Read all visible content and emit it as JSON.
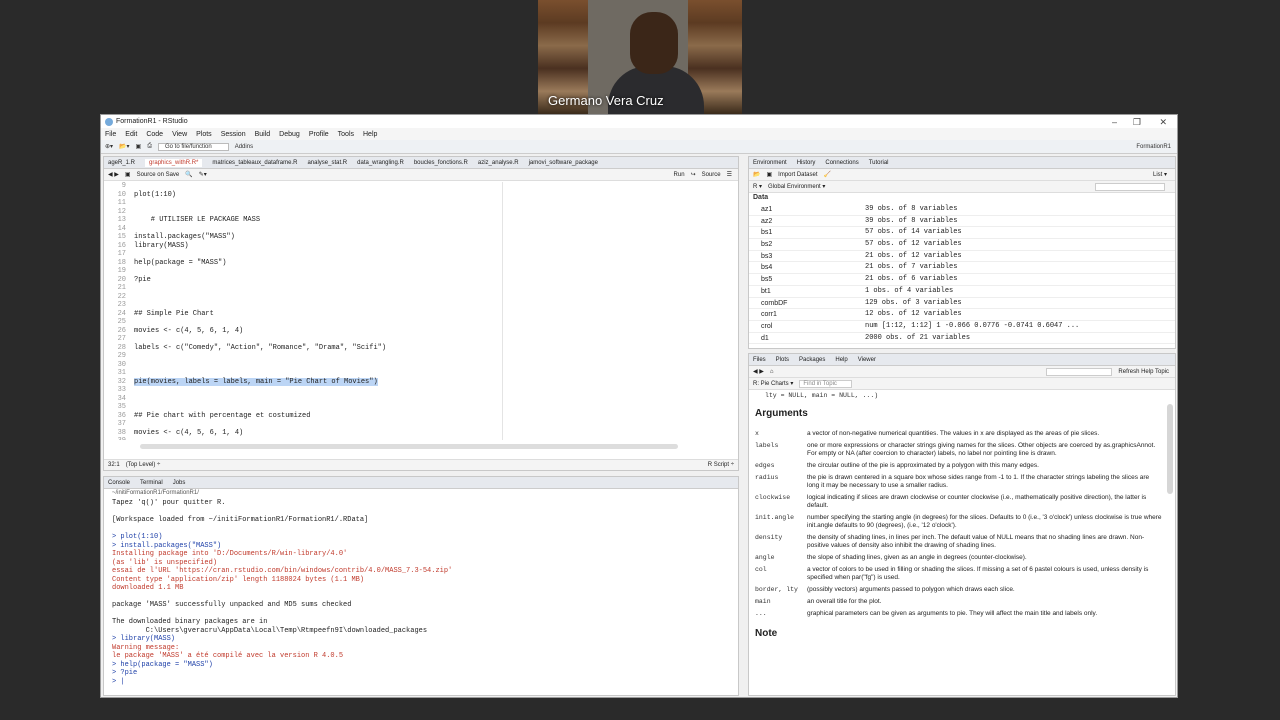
{
  "video": {
    "name": "Germano Vera Cruz"
  },
  "window": {
    "title": "FormationR1 - RStudio",
    "min": "–",
    "max": "❐",
    "close": "✕"
  },
  "menu": [
    "File",
    "Edit",
    "Code",
    "View",
    "Plots",
    "Session",
    "Build",
    "Debug",
    "Profile",
    "Tools",
    "Help"
  ],
  "toolbar": {
    "goto": "Go to file/function",
    "addins": "Addins",
    "project": "FormationR1"
  },
  "editor": {
    "tabs": [
      "ageR_1.R",
      "graphics_withR.R*",
      "matrices_tableaux_dataframe.R",
      "analyse_stat.R",
      "data_wrangling.R",
      "boucles_fonctions.R",
      "aziz_analyse.R",
      "jamovi_software_package"
    ],
    "source_on_save": "Source on Save",
    "run": "Run",
    "source": "Source",
    "lines": [
      {
        "n": "9",
        "t": ""
      },
      {
        "n": "10",
        "t": "plot(1:10)"
      },
      {
        "n": "11",
        "t": ""
      },
      {
        "n": "12",
        "t": ""
      },
      {
        "n": "13",
        "t": "    # UTILISER LE PACKAGE MASS"
      },
      {
        "n": "14",
        "t": ""
      },
      {
        "n": "15",
        "t": "install.packages(\"MASS\")"
      },
      {
        "n": "16",
        "t": "library(MASS)"
      },
      {
        "n": "17",
        "t": ""
      },
      {
        "n": "18",
        "t": "help(package = \"MASS\")"
      },
      {
        "n": "19",
        "t": ""
      },
      {
        "n": "20",
        "t": "?pie"
      },
      {
        "n": "21",
        "t": ""
      },
      {
        "n": "22",
        "t": ""
      },
      {
        "n": "23",
        "t": ""
      },
      {
        "n": "24",
        "t": "## Simple Pie Chart"
      },
      {
        "n": "25",
        "t": ""
      },
      {
        "n": "26",
        "t": "movies <- c(4, 5, 6, 1, 4)"
      },
      {
        "n": "27",
        "t": ""
      },
      {
        "n": "28",
        "t": "labels <- c(\"Comedy\", \"Action\", \"Romance\", \"Drama\", \"Scifi\")"
      },
      {
        "n": "29",
        "t": ""
      },
      {
        "n": "30",
        "t": ""
      },
      {
        "n": "31",
        "t": ""
      },
      {
        "n": "32",
        "t": "pie(movies, labels = labels, main = \"Pie Chart of Movies\")"
      },
      {
        "n": "33",
        "t": ""
      },
      {
        "n": "34",
        "t": ""
      },
      {
        "n": "35",
        "t": ""
      },
      {
        "n": "36",
        "t": "## Pie chart with percentage et costumized"
      },
      {
        "n": "37",
        "t": ""
      },
      {
        "n": "38",
        "t": "movies <- c(4, 5, 6, 1, 4)"
      },
      {
        "n": "39",
        "t": ""
      },
      {
        "n": "40",
        "t": "labels1 <- c(\"Comedy\", \"Action\", \"Romance\", \"Drama\", \"Scifi\")"
      },
      {
        "n": "41",
        "t": ""
      }
    ],
    "status_pos": "32:1",
    "status_level": "(Top Level) ÷",
    "status_type": "R Script ÷"
  },
  "console": {
    "tabs": [
      "Console",
      "Terminal",
      "Jobs"
    ],
    "path": "~/initiFormationR1/FormationR1/",
    "lines": [
      {
        "c": "",
        "t": "Tapez 'q()' pour quitter R."
      },
      {
        "c": "",
        "t": ""
      },
      {
        "c": "",
        "t": "[Workspace loaded from ~/initiFormationR1/FormationR1/.RData]"
      },
      {
        "c": "",
        "t": ""
      },
      {
        "c": "cin",
        "t": "> plot(1:10)"
      },
      {
        "c": "cin",
        "t": "> install.packages(\"MASS\")"
      },
      {
        "c": "cerr",
        "t": "Installing package into 'D:/Documents/R/win-library/4.0'"
      },
      {
        "c": "cerr",
        "t": "(as 'lib' is unspecified)"
      },
      {
        "c": "cerr",
        "t": "essai de l'URL 'https://cran.rstudio.com/bin/windows/contrib/4.0/MASS_7.3-54.zip'"
      },
      {
        "c": "cerr",
        "t": "Content type 'application/zip' length 1188024 bytes (1.1 MB)"
      },
      {
        "c": "cerr",
        "t": "downloaded 1.1 MB"
      },
      {
        "c": "",
        "t": ""
      },
      {
        "c": "",
        "t": "package 'MASS' successfully unpacked and MD5 sums checked"
      },
      {
        "c": "",
        "t": ""
      },
      {
        "c": "",
        "t": "The downloaded binary packages are in"
      },
      {
        "c": "",
        "t": "        C:\\Users\\gveracru\\AppData\\Local\\Temp\\Rtmpeefn9I\\downloaded_packages"
      },
      {
        "c": "cin",
        "t": "> library(MASS)"
      },
      {
        "c": "cerr",
        "t": "Warning message:"
      },
      {
        "c": "cerr",
        "t": "le package 'MASS' a été compilé avec la version R 4.0.5"
      },
      {
        "c": "cin",
        "t": "> help(package = \"MASS\")"
      },
      {
        "c": "cin",
        "t": "> ?pie"
      },
      {
        "c": "cin",
        "t": "> |"
      }
    ]
  },
  "env": {
    "tabs": [
      "Environment",
      "History",
      "Connections",
      "Tutorial"
    ],
    "import": "Import Dataset",
    "scope": "Global Environment ▾",
    "list": "List ▾",
    "section": "Data",
    "rows": [
      {
        "n": "az1",
        "v": "39 obs. of 8 variables"
      },
      {
        "n": "az2",
        "v": "39 obs. of 8 variables"
      },
      {
        "n": "bs1",
        "v": "57 obs. of 14 variables"
      },
      {
        "n": "bs2",
        "v": "57 obs. of 12 variables"
      },
      {
        "n": "bs3",
        "v": "21 obs. of 12 variables"
      },
      {
        "n": "bs4",
        "v": "21 obs. of 7 variables"
      },
      {
        "n": "bs5",
        "v": "21 obs. of 6 variables"
      },
      {
        "n": "bt1",
        "v": "1 obs. of 4 variables"
      },
      {
        "n": "combDF",
        "v": "129 obs. of 3 variables"
      },
      {
        "n": "corr1",
        "v": "12 obs. of 12 variables"
      },
      {
        "n": "crol",
        "v": "num [1:12, 1:12] 1 -0.066 0.0776 -0.0741 0.6047 ..."
      },
      {
        "n": "d1",
        "v": "2000 obs. of 21 variables"
      }
    ]
  },
  "help": {
    "tabs": [
      "Files",
      "Plots",
      "Packages",
      "Help",
      "Viewer"
    ],
    "topic": "R: Pie Charts ▾",
    "find": "Find in Topic",
    "refresh": "Refresh Help Topic",
    "usage_tail": "lty = NULL, main = NULL, ...)",
    "heading": "Arguments",
    "args": [
      {
        "a": "x",
        "d": "a vector of non-negative numerical quantities. The values in x are displayed as the areas of pie slices."
      },
      {
        "a": "labels",
        "d": "one or more expressions or character strings giving names for the slices. Other objects are coerced by as.graphicsAnnot. For empty or NA (after coercion to character) labels, no label nor pointing line is drawn."
      },
      {
        "a": "edges",
        "d": "the circular outline of the pie is approximated by a polygon with this many edges."
      },
      {
        "a": "radius",
        "d": "the pie is drawn centered in a square box whose sides range from -1 to 1. If the character strings labeling the slices are long it may be necessary to use a smaller radius."
      },
      {
        "a": "clockwise",
        "d": "logical indicating if slices are drawn clockwise or counter clockwise (i.e., mathematically positive direction), the latter is default."
      },
      {
        "a": "init.angle",
        "d": "number specifying the starting angle (in degrees) for the slices. Defaults to 0 (i.e., '3 o'clock') unless clockwise is true where init.angle defaults to 90 (degrees), (i.e., '12 o'clock')."
      },
      {
        "a": "density",
        "d": "the density of shading lines, in lines per inch. The default value of NULL means that no shading lines are drawn. Non-positive values of density also inhibit the drawing of shading lines."
      },
      {
        "a": "angle",
        "d": "the slope of shading lines, given as an angle in degrees (counter-clockwise)."
      },
      {
        "a": "col",
        "d": "a vector of colors to be used in filling or shading the slices. If missing a set of 6 pastel colours is used, unless density is specified when par(\"fg\") is used."
      },
      {
        "a": "border, lty",
        "d": "(possibly vectors) arguments passed to polygon which draws each slice."
      },
      {
        "a": "main",
        "d": "an overall title for the plot."
      },
      {
        "a": "...",
        "d": "graphical parameters can be given as arguments to pie. They will affect the main title and labels only."
      }
    ],
    "note": "Note"
  }
}
